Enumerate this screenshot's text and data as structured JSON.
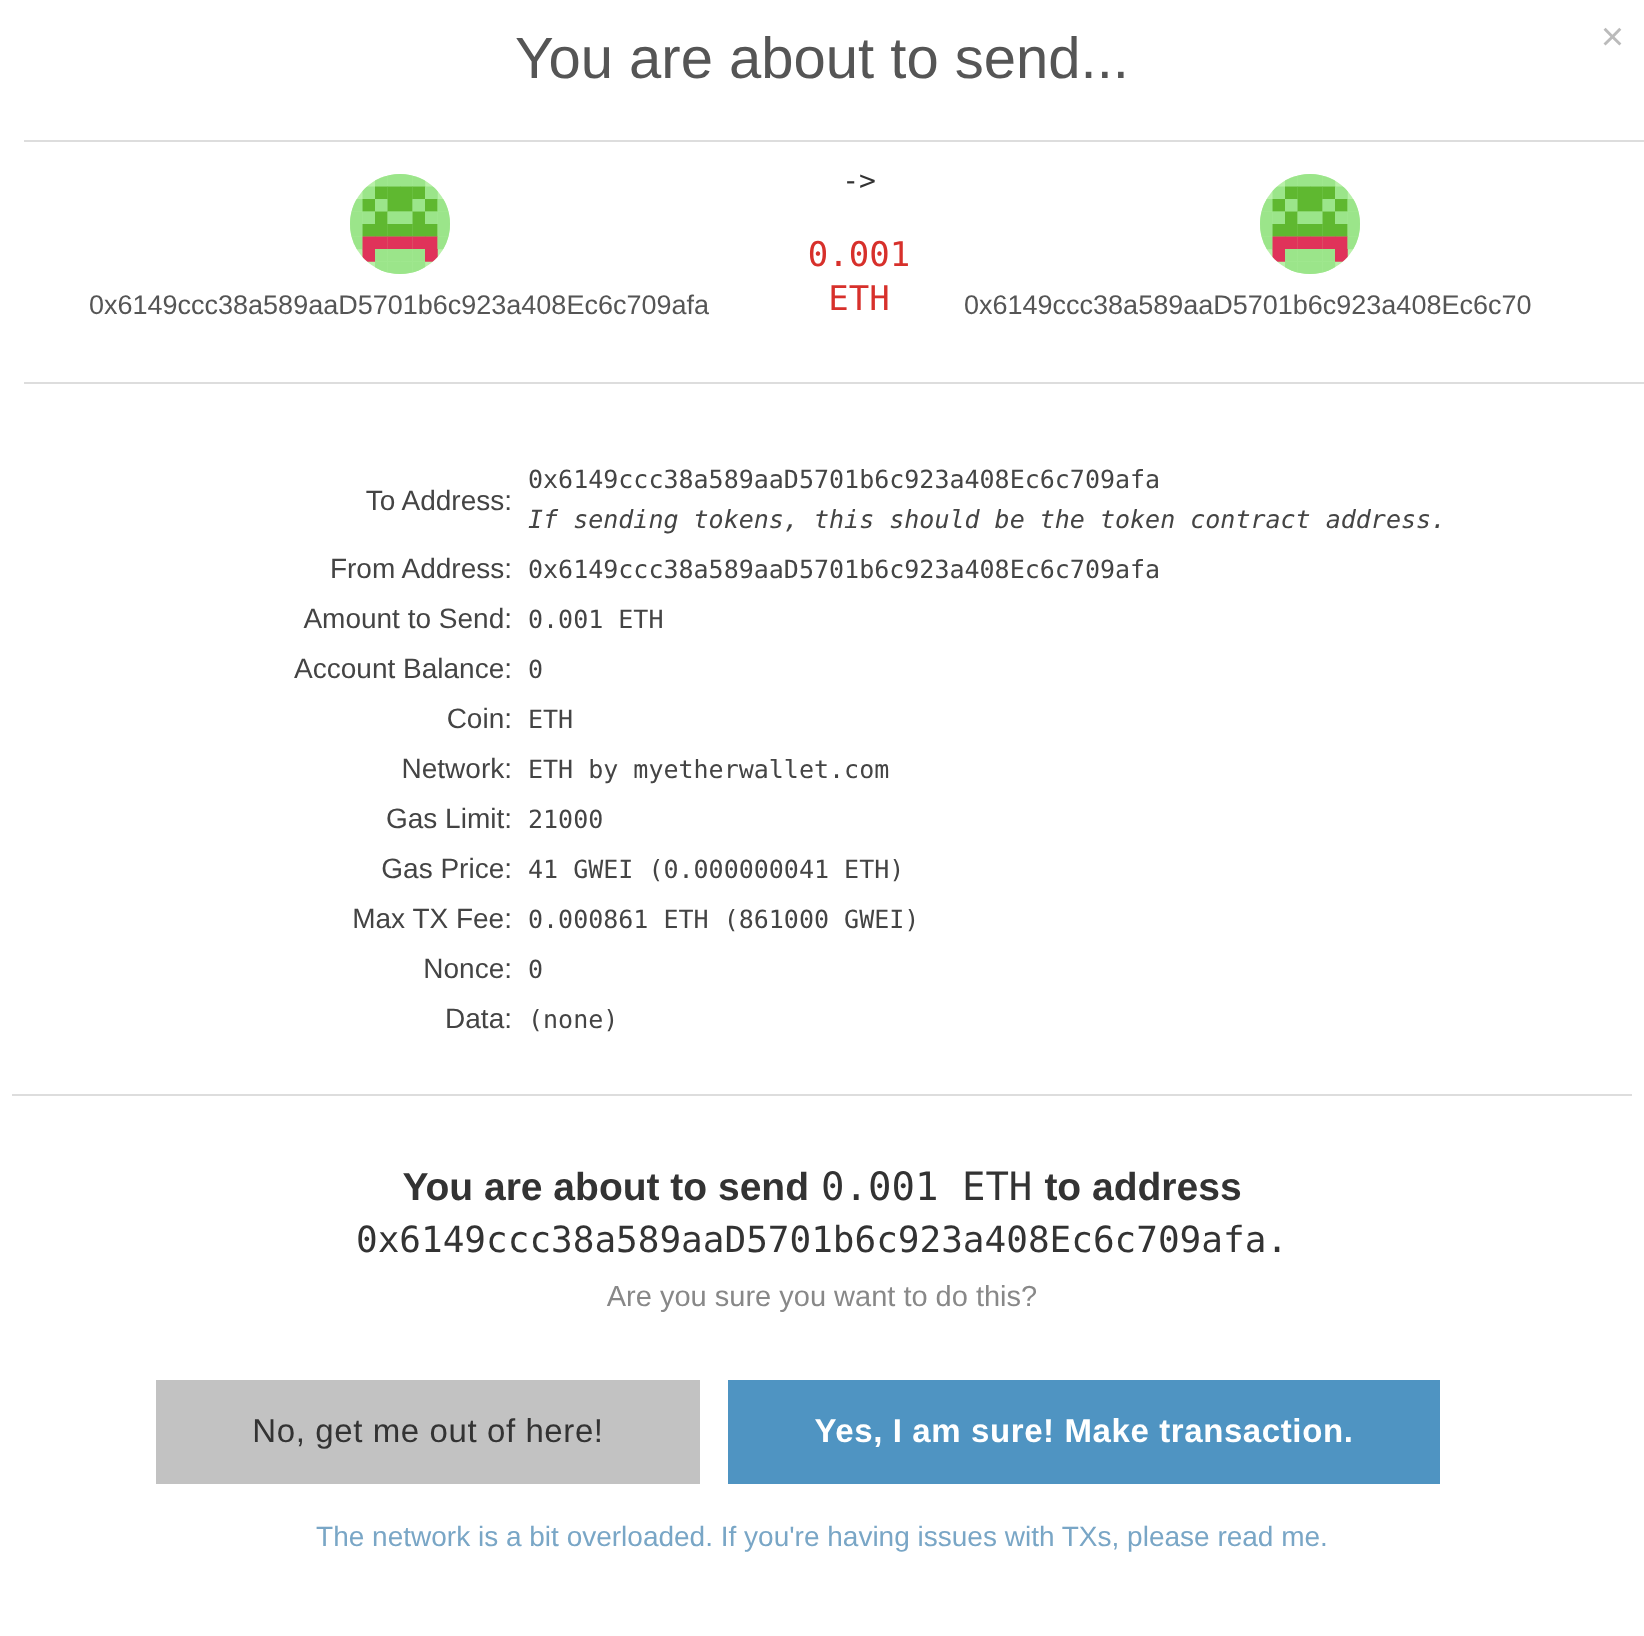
{
  "modal": {
    "title": "You are about to send...",
    "close": "×"
  },
  "summary": {
    "from_address": "0x6149ccc38a589aaD5701b6c923a408Ec6c709afa",
    "arrow": "->",
    "amount": "0.001",
    "unit": "ETH",
    "to_address": "0x6149ccc38a589aaD5701b6c923a408Ec6c70"
  },
  "details": [
    {
      "label": "To Address:",
      "value": "0x6149ccc38a589aaD5701b6c923a408Ec6c709afa",
      "note": "If sending tokens, this should be the token contract address."
    },
    {
      "label": "From Address:",
      "value": "0x6149ccc38a589aaD5701b6c923a408Ec6c709afa"
    },
    {
      "label": "Amount to Send:",
      "value": "0.001 ETH"
    },
    {
      "label": "Account Balance:",
      "value": "0"
    },
    {
      "label": "Coin:",
      "value": "ETH"
    },
    {
      "label": "Network:",
      "value": "ETH by myetherwallet.com"
    },
    {
      "label": "Gas Limit:",
      "value": "21000"
    },
    {
      "label": "Gas Price:",
      "value": "41 GWEI (0.000000041 ETH)"
    },
    {
      "label": "Max TX Fee:",
      "value": "0.000861 ETH (861000 GWEI)"
    },
    {
      "label": "Nonce:",
      "value": "0"
    },
    {
      "label": "Data:",
      "value": "(none)"
    }
  ],
  "confirm": {
    "prefix": "You are about to send",
    "amount": "0.001 ETH",
    "middle": "to address",
    "address": "0x6149ccc38a589aaD5701b6c923a408Ec6c709afa.",
    "question": "Are you sure you want to do this?"
  },
  "buttons": [
    {
      "kind": "cancel",
      "label": "No, get me out of here!"
    },
    {
      "kind": "confirm",
      "label": "Yes, I am sure! Make transaction."
    }
  ],
  "footer_note": "The network is a bit overloaded. If you're having issues with TXs, please read me."
}
